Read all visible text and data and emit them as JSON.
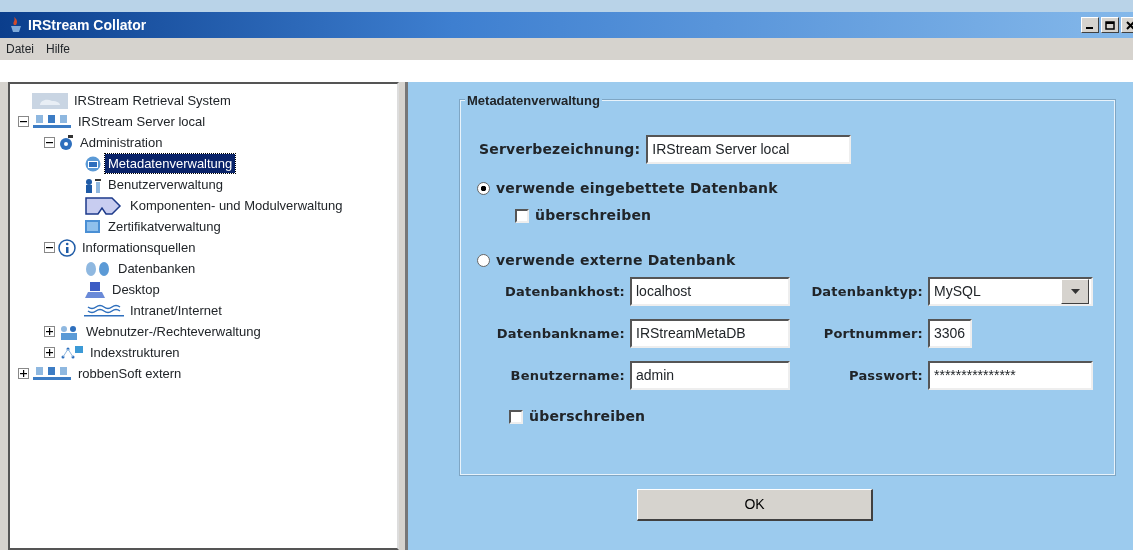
{
  "window": {
    "title": "IRStream Collator"
  },
  "menu": [
    "Datei",
    "Hilfe"
  ],
  "tree": [
    {
      "label": "IRStream Retrieval System",
      "kind": "system",
      "selected": false
    },
    {
      "label": "IRStream Server local",
      "kind": "server",
      "expanded": true,
      "selected": false,
      "children": [
        {
          "label": "Administration",
          "kind": "admin",
          "expanded": true,
          "selected": false,
          "children": [
            {
              "label": "Metadatenverwaltung",
              "kind": "meta",
              "selected": true
            },
            {
              "label": "Benutzerverwaltung",
              "kind": "users",
              "selected": false
            },
            {
              "label": "Komponenten- und Modulverwaltung",
              "kind": "module",
              "selected": false
            },
            {
              "label": "Zertifikatverwaltung",
              "kind": "cert",
              "selected": false
            }
          ]
        },
        {
          "label": "Informationsquellen",
          "kind": "info",
          "expanded": true,
          "selected": false,
          "children": [
            {
              "label": "Datenbanken",
              "kind": "db",
              "selected": false
            },
            {
              "label": "Desktop",
              "kind": "desktop",
              "selected": false
            },
            {
              "label": "Intranet/Internet",
              "kind": "net",
              "selected": false
            }
          ]
        },
        {
          "label": "Webnutzer-/Rechteverwaltung",
          "kind": "webusers",
          "expanded": false,
          "selected": false
        },
        {
          "label": "Indexstrukturen",
          "kind": "index",
          "expanded": false,
          "selected": false
        }
      ]
    },
    {
      "label": "robbenSoft extern",
      "kind": "server",
      "expanded": false,
      "selected": false
    }
  ],
  "form": {
    "legend": "Metadatenverwaltung",
    "server_label": "Serverbezeichnung:",
    "server_value": "IRStream Server local",
    "embedded": {
      "label": "verwende eingebettete Datenbank",
      "selected": true,
      "overwrite": {
        "label": "überschreiben",
        "checked": false
      }
    },
    "external": {
      "label": "verwende externe Datenbank",
      "selected": false,
      "overwrite": {
        "label": "überschreiben",
        "checked": false
      }
    },
    "fields": [
      {
        "label": "Datenbankhost:",
        "value": "localhost",
        "kind": "text"
      },
      {
        "label": "Datenbanktyp:",
        "value": "MySQL",
        "kind": "select"
      },
      {
        "label": "Datenbankname:",
        "value": "IRStreamMetaDB",
        "kind": "text"
      },
      {
        "label": "Portnummer:",
        "value": "3306",
        "kind": "short"
      },
      {
        "label": "Benutzername:",
        "value": "admin",
        "kind": "text"
      },
      {
        "label": "Passwort:",
        "value": "***************",
        "kind": "text"
      }
    ]
  },
  "ok_button": "OK"
}
